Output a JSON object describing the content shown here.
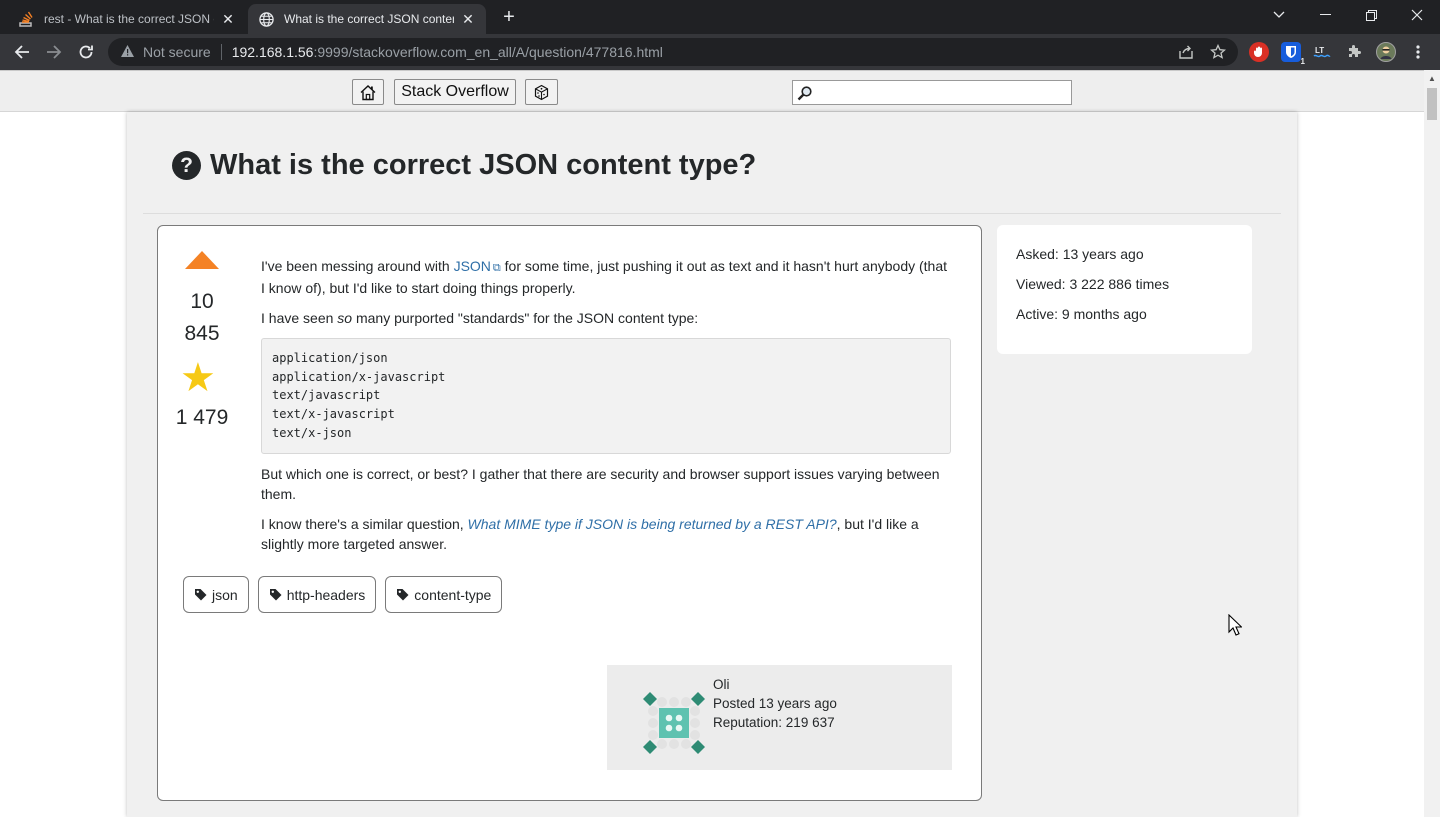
{
  "browser": {
    "tabs": [
      {
        "title": "rest - What is the correct JSON co",
        "active": false,
        "favicon": "stackoverflow-icon"
      },
      {
        "title": "What is the correct JSON content",
        "active": true,
        "favicon": "globe-icon"
      }
    ],
    "address": {
      "security_label": "Not secure",
      "host": "192.168.1.56",
      "path": ":9999/stackoverflow.com_en_all/A/question/477816.html"
    }
  },
  "site_header": {
    "home_icon": "home-icon",
    "site_button_label": "Stack Overflow",
    "random_icon": "dice-icon",
    "search_placeholder": ""
  },
  "question": {
    "title": "What is the correct JSON content type?",
    "votes_line1": "10",
    "votes_line2": "845",
    "favorites": "1 479",
    "body": {
      "p1_before_link": "I've been messing around with ",
      "p1_link": "JSON",
      "p1_after_link": " for some time, just pushing it out as text and it hasn't hurt anybody (that I know of), but I'd like to start doing things properly.",
      "p2_before": "I have seen ",
      "p2_em": "so",
      "p2_after": " many purported \"standards\" for the JSON content type:",
      "code_lines": [
        "application/json",
        "application/x-javascript",
        "text/javascript",
        "text/x-javascript",
        "text/x-json"
      ],
      "p3": "But which one is correct, or best? I gather that there are security and browser support issues varying between them.",
      "p4_before": "I know there's a similar question, ",
      "p4_link": "What MIME type if JSON is being returned by a REST API?",
      "p4_after": ", but I'd like a slightly more targeted answer."
    },
    "tags": [
      "json",
      "http-headers",
      "content-type"
    ],
    "owner": {
      "name": "Oli",
      "posted": "Posted 13 years ago",
      "reputation": "Reputation: 219 637"
    }
  },
  "stats": {
    "asked": "Asked: 13 years ago",
    "viewed": "Viewed: 3 222 886 times",
    "active": "Active: 9 months ago"
  },
  "colors": {
    "upvote": "#f48225",
    "star": "#f6c915",
    "link": "#2f6fa7",
    "identicon": "#2e8b74"
  }
}
